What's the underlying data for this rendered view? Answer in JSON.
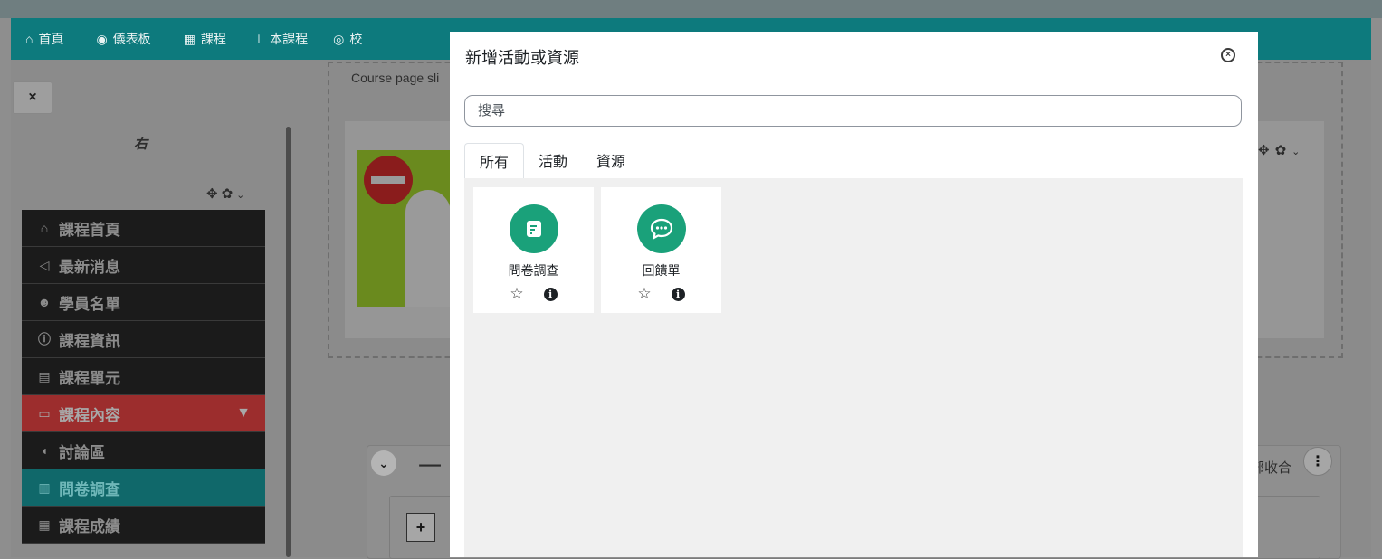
{
  "navbar": {
    "items": [
      {
        "icon": "home-icon",
        "label": "首頁"
      },
      {
        "icon": "dashboard-icon",
        "label": "儀表板"
      },
      {
        "icon": "grid-icon",
        "label": "課程"
      },
      {
        "icon": "sitemap-icon",
        "label": "本課程"
      },
      {
        "icon": "lifebuoy-icon",
        "label": "校"
      }
    ]
  },
  "page": {
    "close_symbol": "×",
    "block_region_label": "右",
    "slider_text": "Course page sli",
    "section_title_fragment": "一",
    "collapse_all": "部收合",
    "add_symbol": "+",
    "kebab_symbol": "⋮",
    "chevron_symbol": "⌄"
  },
  "sidebar_menu": {
    "items": [
      {
        "icon": "home-icon",
        "glyph": "⌂",
        "label": "課程首頁",
        "state": "normal"
      },
      {
        "icon": "bullhorn-icon",
        "glyph": "📢",
        "label": "最新消息",
        "state": "normal"
      },
      {
        "icon": "users-icon",
        "glyph": "👥",
        "label": "學員名單",
        "state": "normal"
      },
      {
        "icon": "info-icon",
        "glyph": "ⓘ",
        "label": "課程資訊",
        "state": "normal"
      },
      {
        "icon": "list-icon",
        "glyph": "▤",
        "label": "課程單元",
        "state": "normal"
      },
      {
        "icon": "monitor-icon",
        "glyph": "▭",
        "label": "課程內容",
        "state": "active",
        "arrow": "▼"
      },
      {
        "icon": "comments-icon",
        "glyph": "💬",
        "label": "討論區",
        "state": "normal"
      },
      {
        "icon": "bar-chart-icon",
        "glyph": "📊",
        "label": "問卷調查",
        "state": "teal"
      },
      {
        "icon": "table-icon",
        "glyph": "▦",
        "label": "課程成績",
        "state": "normal"
      }
    ]
  },
  "modal": {
    "title": "新增活動或資源",
    "close_symbol": "×",
    "search_placeholder": "搜尋",
    "tabs": [
      {
        "label": "所有",
        "active": true
      },
      {
        "label": "活動",
        "active": false
      },
      {
        "label": "資源",
        "active": false
      }
    ],
    "cards": [
      {
        "icon": "questionnaire-icon",
        "label": "問卷調查"
      },
      {
        "icon": "feedback-icon",
        "label": "回饋單"
      }
    ],
    "star_symbol": "☆",
    "info_symbol": "i",
    "icon_color": "#1aa17a"
  },
  "colors": {
    "navbar": "#0d7a7d",
    "active_menu": "#9c2d2d",
    "teal_menu": "#10686a"
  }
}
